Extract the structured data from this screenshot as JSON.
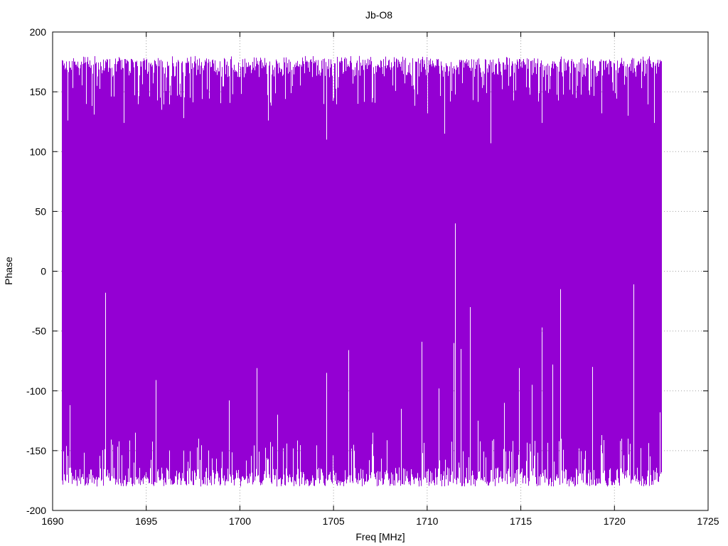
{
  "chart_data": {
    "type": "line",
    "title": "Jb-O8",
    "xlabel": "Freq [MHz]",
    "ylabel": "Phase",
    "xlim": [
      1690,
      1725
    ],
    "ylim": [
      -200,
      200
    ],
    "xticks": [
      1690,
      1695,
      1700,
      1705,
      1710,
      1715,
      1720,
      1725
    ],
    "yticks": [
      -200,
      -150,
      -100,
      -50,
      0,
      50,
      100,
      150,
      200
    ],
    "grid": true,
    "color": "#9400d3",
    "series": [
      {
        "x_range": [
          1690.5,
          1722.5
        ],
        "envelope_max": 180,
        "envelope_min": -180,
        "typical_max": 170,
        "typical_min": -172,
        "gaps_top": [
          {
            "x": 1690.8,
            "y": 126
          },
          {
            "x": 1692.2,
            "y": 131
          },
          {
            "x": 1693.8,
            "y": 124
          },
          {
            "x": 1695.8,
            "y": 135
          },
          {
            "x": 1697.0,
            "y": 128
          },
          {
            "x": 1701.5,
            "y": 126
          },
          {
            "x": 1704.6,
            "y": 110
          },
          {
            "x": 1706.3,
            "y": 140
          },
          {
            "x": 1710.0,
            "y": 132
          },
          {
            "x": 1710.9,
            "y": 115
          },
          {
            "x": 1713.4,
            "y": 107
          },
          {
            "x": 1716.1,
            "y": 124
          },
          {
            "x": 1719.3,
            "y": 132
          },
          {
            "x": 1720.7,
            "y": 130
          },
          {
            "x": 1722.1,
            "y": 124
          }
        ],
        "gaps_bottom": [
          {
            "x": 1690.9,
            "y": -112
          },
          {
            "x": 1692.8,
            "y": -18
          },
          {
            "x": 1693.2,
            "y": -145
          },
          {
            "x": 1694.4,
            "y": -135
          },
          {
            "x": 1695.5,
            "y": -91
          },
          {
            "x": 1697.8,
            "y": -140
          },
          {
            "x": 1699.4,
            "y": -108
          },
          {
            "x": 1700.9,
            "y": -81
          },
          {
            "x": 1702.0,
            "y": -120
          },
          {
            "x": 1704.6,
            "y": -85
          },
          {
            "x": 1705.8,
            "y": -66
          },
          {
            "x": 1707.1,
            "y": -135
          },
          {
            "x": 1708.6,
            "y": -115
          },
          {
            "x": 1709.7,
            "y": -59
          },
          {
            "x": 1710.6,
            "y": -98
          },
          {
            "x": 1711.4,
            "y": -60
          },
          {
            "x": 1711.5,
            "y": 40
          },
          {
            "x": 1711.8,
            "y": -65
          },
          {
            "x": 1712.3,
            "y": -30
          },
          {
            "x": 1712.7,
            "y": -125
          },
          {
            "x": 1714.1,
            "y": -110
          },
          {
            "x": 1714.9,
            "y": -81
          },
          {
            "x": 1715.6,
            "y": -95
          },
          {
            "x": 1716.1,
            "y": -47
          },
          {
            "x": 1716.7,
            "y": -78
          },
          {
            "x": 1717.1,
            "y": -15
          },
          {
            "x": 1718.8,
            "y": -80
          },
          {
            "x": 1719.3,
            "y": -137
          },
          {
            "x": 1720.7,
            "y": -140
          },
          {
            "x": 1721.0,
            "y": -11
          },
          {
            "x": 1722.4,
            "y": -118
          }
        ]
      }
    ]
  }
}
